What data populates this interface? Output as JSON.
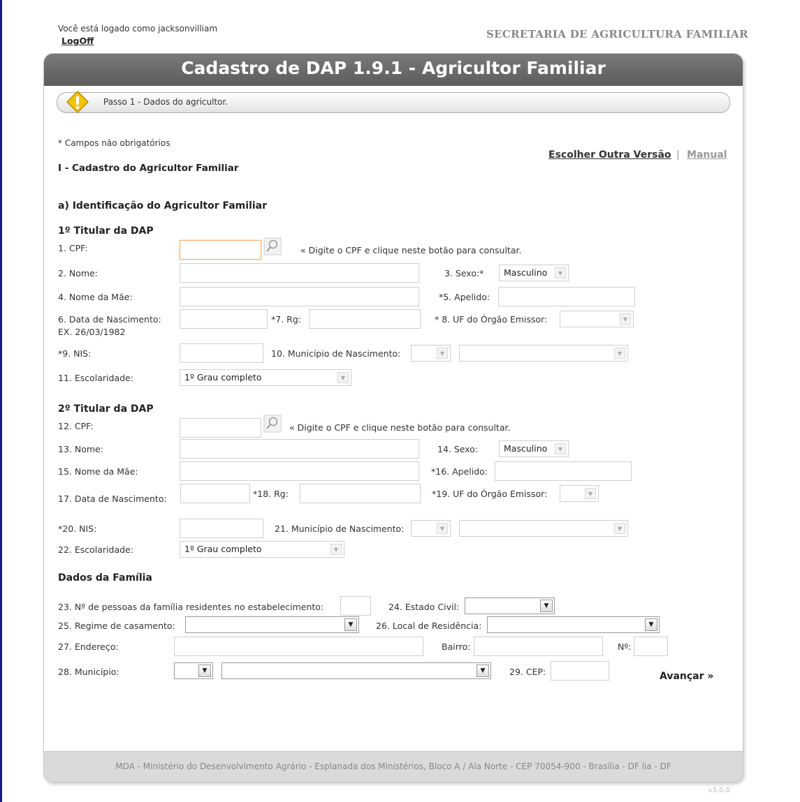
{
  "header": {
    "logged_text": "Você está logado como jacksonvilliam",
    "logoff": "LogOff",
    "secretaria": "SECRETARIA DE AGRICULTURA FAMILIAR"
  },
  "card": {
    "title": "Cadastro de DAP 1.9.1 - Agricultor Familiar",
    "step": "Passo 1 - Dados do agricultor."
  },
  "intro": {
    "optional_note": "* Campos não obrigatórios",
    "section": "I - Cadastro do Agricultor Familiar",
    "escolher": "Escolher Outra Versão",
    "sep": "|",
    "manual": "Manual"
  },
  "identificacao": {
    "heading": "a) Identificação do Agricultor Familiar"
  },
  "t1": {
    "heading": "1º Titular da DAP",
    "cpf_label": "1. CPF:",
    "cpf_hint": "« Digite o CPF e clique neste botão para consultar.",
    "nome_label": "2. Nome:",
    "sexo_label": "3. Sexo:*",
    "sexo_value": "Masculino",
    "mae_label": "4. Nome da Mãe:",
    "apelido_label": "*5. Apelido:",
    "nasc_label": "6. Data de Nascimento:",
    "nasc_example": "EX.  26/03/1982",
    "rg_label": "*7. Rg:",
    "uf_label": "* 8. UF do Órgão Emissor:",
    "nis_label": "*9. NIS:",
    "mun_label": "10. Município de Nascimento:",
    "esc_label": "11. Escolaridade:",
    "esc_value": "1º Grau completo"
  },
  "t2": {
    "heading": "2º Titular da DAP",
    "cpf_label": "12. CPF:",
    "cpf_hint": "« Digite o CPF e clique neste botão para consultar.",
    "nome_label": "13. Nome:",
    "sexo_label": "14. Sexo:",
    "sexo_value": "Masculino",
    "mae_label": "15. Nome da Mãe:",
    "apelido_label": "*16. Apelido:",
    "nasc_label": "17. Data de Nascimento:",
    "rg_label": "*18. Rg:",
    "uf_label": "*19. UF do Órgão Emissor:",
    "nis_label": "*20. NIS:",
    "mun_label": "21. Município de Nascimento:",
    "esc_label": "22. Escolaridade:",
    "esc_value": "1º Grau completo"
  },
  "familia": {
    "heading": "Dados da Família",
    "pessoas_label": "23. Nº de pessoas da família residentes no estabelecimento:",
    "civil_label": "24. Estado Civil:",
    "regime_label": "25. Regime de casamento:",
    "local_label": "26. Local de Residência:",
    "endereco_label": "27. Endereço:",
    "bairro_label": "Bairro:",
    "numero_label": "Nº:",
    "municipio_label": "28. Município:",
    "cep_label": "29. CEP:"
  },
  "actions": {
    "avancar": "Avançar »"
  },
  "footer": {
    "text": "MDA - Ministério do Desenvolvimento Agrário - Esplanada dos Ministérios, Bloco A / Ala Norte - CEP 70054-900 - Brasília - DF lia - DF",
    "version": "v3.0.0"
  },
  "icons": {
    "warning": "warning-icon",
    "search": "magnifier-icon",
    "dropdown": "chevron-down-icon"
  }
}
